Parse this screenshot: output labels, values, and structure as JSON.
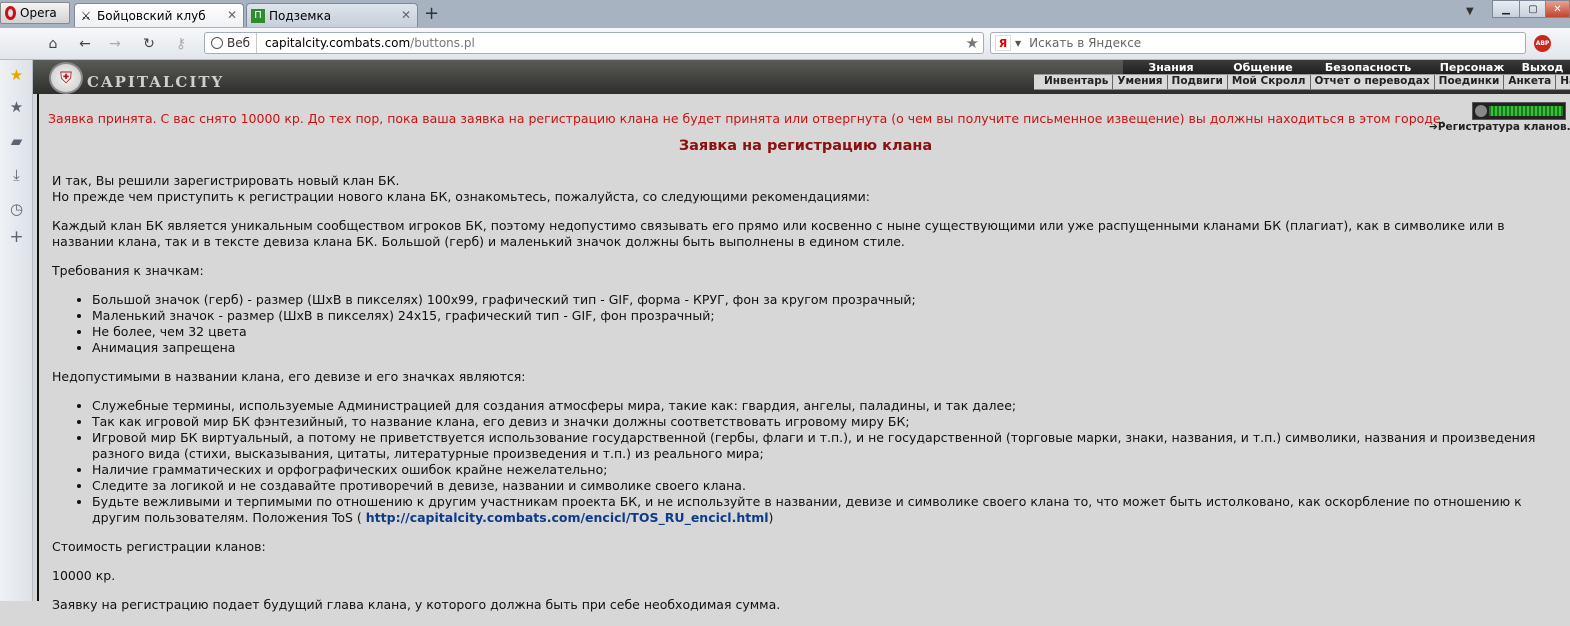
{
  "browser": {
    "menu_label": "Opera",
    "tabs": [
      {
        "title": "Бойцовский клуб",
        "icon": "swords-icon",
        "active": true
      },
      {
        "title": "Подземка",
        "icon": "dungeon-icon",
        "active": false
      }
    ],
    "new_tab": "+",
    "web_chip": "Веб",
    "url_host": "capitalcity.combats.com",
    "url_path": "/buttons.pl",
    "search_placeholder": "Искать в Яндексе",
    "search_engine": "Я",
    "adblock": "ABP"
  },
  "site": {
    "logo_text": "CAPITALCITY",
    "top_menu": [
      "Знания",
      "Общение",
      "Безопасность",
      "Персонаж",
      "Выход"
    ],
    "sub_menu": [
      "Инвентарь",
      "Умения",
      "Подвиги",
      "Мой Скролл",
      "Отчет о переводах",
      "Поединки",
      "Анкета",
      "Настройки"
    ]
  },
  "content": {
    "notice": "Заявка принята. С вас снято 10000 кр. До тех пор, пока ваша заявка на регистрацию клана не будет принята или отвергнута (о чем вы получите письменное извещение) вы должны находиться в этом городе.",
    "registry_link": "Регистратура кланов.",
    "title": "Заявка на регистрацию клана",
    "intro_1": "И так, Вы решили зарегистрировать новый клан БК.",
    "intro_2": "Но прежде чем приступить к регистрации нового клана БК, ознакомьтесь, пожалуйста, со следующими рекомендациями:",
    "para_unique": "Каждый клан БК является уникальным сообществом игроков БК, поэтому недопустимо связывать его прямо или косвенно с ныне существующими или уже распущенными кланами БК (плагиат), как в символике или в названии клана, так и в тексте девиза клана БК. Большой (герб) и маленький значок должны быть выполнены в едином стиле.",
    "req_heading": "Требования к значкам:",
    "requirements": [
      "Большой значок (герб) - размер (ШхВ в пикселях) 100x99, графический тип - GIF, форма - КРУГ, фон за кругом прозрачный;",
      "Маленький значок - размер (ШхВ в пикселях) 24x15, графический тип - GIF, фон прозрачный;",
      "Не более, чем 32 цвета",
      "Анимация запрещена"
    ],
    "forbid_heading": "Недопустимыми в названии клана, его девизе и его значках являются:",
    "forbidden": [
      "Служебные термины, используемые Администрацией для создания атмосферы мира, такие как: гвардия, ангелы, паладины, и так далее;",
      "Так как игровой мир БК фэнтезийный, то название клана, его девиз и значки должны соответствовать игровому миру БК;",
      "Игровой мир БК виртуальный, а потому не приветствуется использование государственной (гербы, флаги и т.п.), и не государственной (торговые марки, знаки, названия, и т.п.) символики, названия и произведения разного вида (стихи, высказывания, цитаты, литературные произведения и т.п.) из реального мира;",
      "Наличие грамматических и орфографических ошибок крайне нежелательно;",
      "Следите за логикой и не создавайте противоречий в девизе, названии и символике своего клана."
    ],
    "forbidden_last": "Будьте вежливыми и терпимыми по отношению к другим участникам проекта БК, и не используйте в названии, девизе и символике своего клана то, что может быть истолковано, как оскорбление по отношению к другим пользователям. Положения ToS (",
    "tos_link": "http://capitalcity.combats.com/encicl/TOS_RU_encicl.html",
    "tos_close": ")",
    "cost_label": "Стоимость регистрации кланов:",
    "cost_value": "10000 кр.",
    "final_note": "Заявку на регистрацию подает будущий глава клана, у которого должна быть при себе необходимая сумма."
  }
}
